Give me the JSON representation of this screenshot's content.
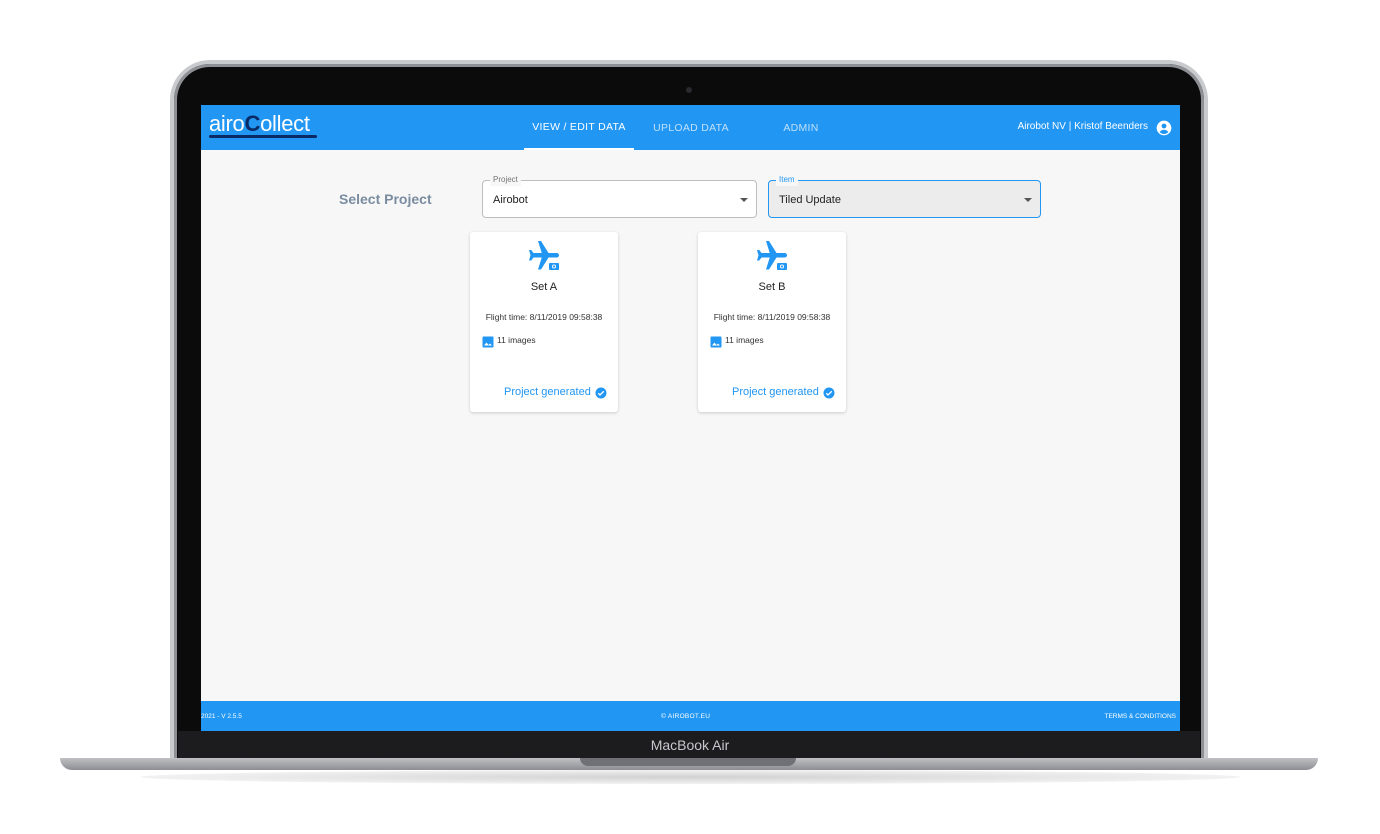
{
  "device": {
    "model_label": "MacBook Air"
  },
  "app": {
    "logo": {
      "part1": "airo",
      "part2": "C",
      "part3": "ollect"
    },
    "nav": [
      {
        "label": "VIEW / EDIT DATA",
        "active": true
      },
      {
        "label": "UPLOAD DATA",
        "active": false
      },
      {
        "label": "ADMIN",
        "active": false
      }
    ],
    "user_label": "Airobot NV | Kristof Beenders",
    "colors": {
      "primary": "#2196f3",
      "background": "#f7f7f7"
    }
  },
  "main": {
    "select_label": "Select Project",
    "project_field": {
      "legend": "Project",
      "value": "Airobot"
    },
    "item_field": {
      "legend": "Item",
      "value": "Tiled Update"
    },
    "cards": [
      {
        "title": "Set A",
        "flight_time": "Flight time: 8/11/2019 09:58:38",
        "images": "11 images",
        "status": "Project generated"
      },
      {
        "title": "Set B",
        "flight_time": "Flight time: 8/11/2019 09:58:38",
        "images": "11 images",
        "status": "Project generated"
      }
    ]
  },
  "footer": {
    "version": "2021 - V 2.5.5",
    "copyright": "©  AIROBOT.EU",
    "terms": "TERMS & CONDITIONS"
  }
}
